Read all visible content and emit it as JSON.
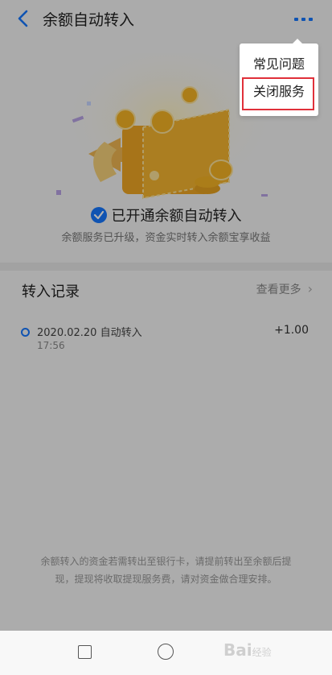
{
  "header": {
    "title": "余额自动转入"
  },
  "hero": {
    "status": "已开通余额自动转入",
    "subtitle": "余额服务已升级，资金实时转入余额宝享收益"
  },
  "records": {
    "title": "转入记录",
    "see_more": "查看更多",
    "items": [
      {
        "date_type": "2020.02.20  自动转入",
        "time": "17:56",
        "amount": "+1.00"
      }
    ],
    "notice": "余额转入的资金若需转出至银行卡，请提前转出至余额后提现，提现将收取提现服务费，请对资金做合理安排。"
  },
  "menu": {
    "items": [
      "常见问题",
      "关闭服务"
    ]
  },
  "watermark": {
    "text": "Bai",
    "suffix": "经验"
  },
  "colors": {
    "accent": "#1677ff",
    "coin": "#f5b324",
    "highlight": "#e0303a"
  }
}
